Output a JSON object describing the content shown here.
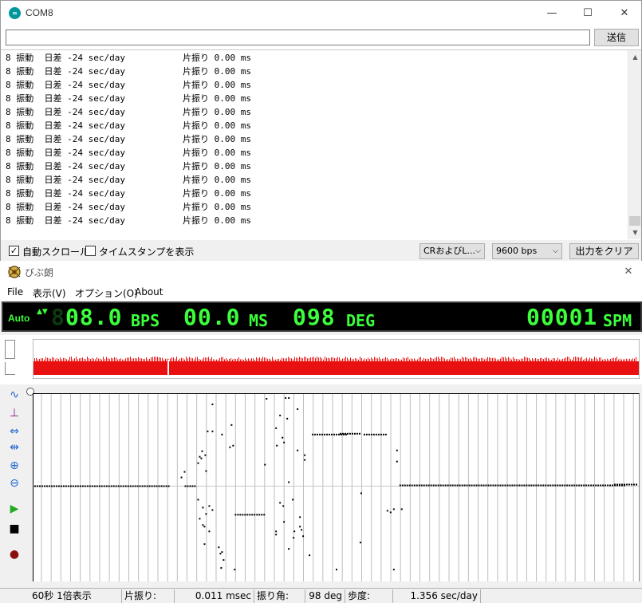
{
  "serial_monitor": {
    "title": "COM8",
    "window_controls": {
      "minimize": "—",
      "maximize": "☐",
      "close": "✕"
    },
    "send_input": {
      "value": "",
      "placeholder": ""
    },
    "send_button": "送信",
    "lines": [
      {
        "a": "8 振動  日差 -24 sec/day",
        "b": "片振り 0.00 ms"
      },
      {
        "a": "8 振動  日差 -24 sec/day",
        "b": "片振り 0.00 ms"
      },
      {
        "a": "8 振動  日差 -24 sec/day",
        "b": "片振り 0.00 ms"
      },
      {
        "a": "8 振動  日差 -24 sec/day",
        "b": "片振り 0.00 ms"
      },
      {
        "a": "8 振動  日差 -24 sec/day",
        "b": "片振り 0.00 ms"
      },
      {
        "a": "8 振動  日差 -24 sec/day",
        "b": "片振り 0.00 ms"
      },
      {
        "a": "8 振動  日差 -24 sec/day",
        "b": "片振り 0.00 ms"
      },
      {
        "a": "8 振動  日差 -24 sec/day",
        "b": "片振り 0.00 ms"
      },
      {
        "a": "8 振動  日差 -24 sec/day",
        "b": "片振り 0.00 ms"
      },
      {
        "a": "8 振動  日差 -24 sec/day",
        "b": "片振り 0.00 ms"
      },
      {
        "a": "8 振動  日差 -24 sec/day",
        "b": "片振り 0.00 ms"
      },
      {
        "a": "8 振動  日差 -24 sec/day",
        "b": "片振り 0.00 ms"
      },
      {
        "a": "8 振動  日差 -24 sec/day",
        "b": "片振り 0.00 ms"
      }
    ],
    "autoscroll": {
      "label": "自動スクロール",
      "checked": true,
      "mark": "✓"
    },
    "timestamp": {
      "label": "タイムスタンプを表示",
      "checked": false
    },
    "line_ending": "CRおよびL...",
    "baud_rate": "9600 bps",
    "clear_button": "出力をクリア",
    "scroll_up_icon": "▲",
    "scroll_down_icon": "▼"
  },
  "vibro": {
    "title": "びぶ朗",
    "close": "✕",
    "menu": {
      "file": "File",
      "view": "表示(V)",
      "options": "オプション(O)",
      "about": "About"
    },
    "auto_label": "Auto",
    "auto_arrows": "▲▼",
    "led": {
      "bps_ghost": "88",
      "bps_value": "08.0",
      "bps_unit": "BPS",
      "ms_value": "00.0",
      "ms_unit": "MS",
      "deg_value": "098",
      "deg_unit": "DEG",
      "spm_value": "00001",
      "spm_unit": "SPM"
    },
    "led_color": "#3cff3c",
    "waveform_color": "#e81010",
    "tools": {
      "wave": "∿",
      "trigger": "⊥",
      "hscale": "⇔",
      "hshrink": "⇹",
      "zoom_in": "⊕",
      "zoom_out": "⊖",
      "play": "▶",
      "stop": "■",
      "record": "●"
    },
    "status": {
      "mode": "60秒 1倍表示",
      "amp_label": "片振り:",
      "amp_value": "0.011 msec",
      "angle_label": "振り角:",
      "angle_value": "98 deg",
      "rate_label": "歩度:",
      "rate_value": "1.356 sec/day"
    }
  }
}
